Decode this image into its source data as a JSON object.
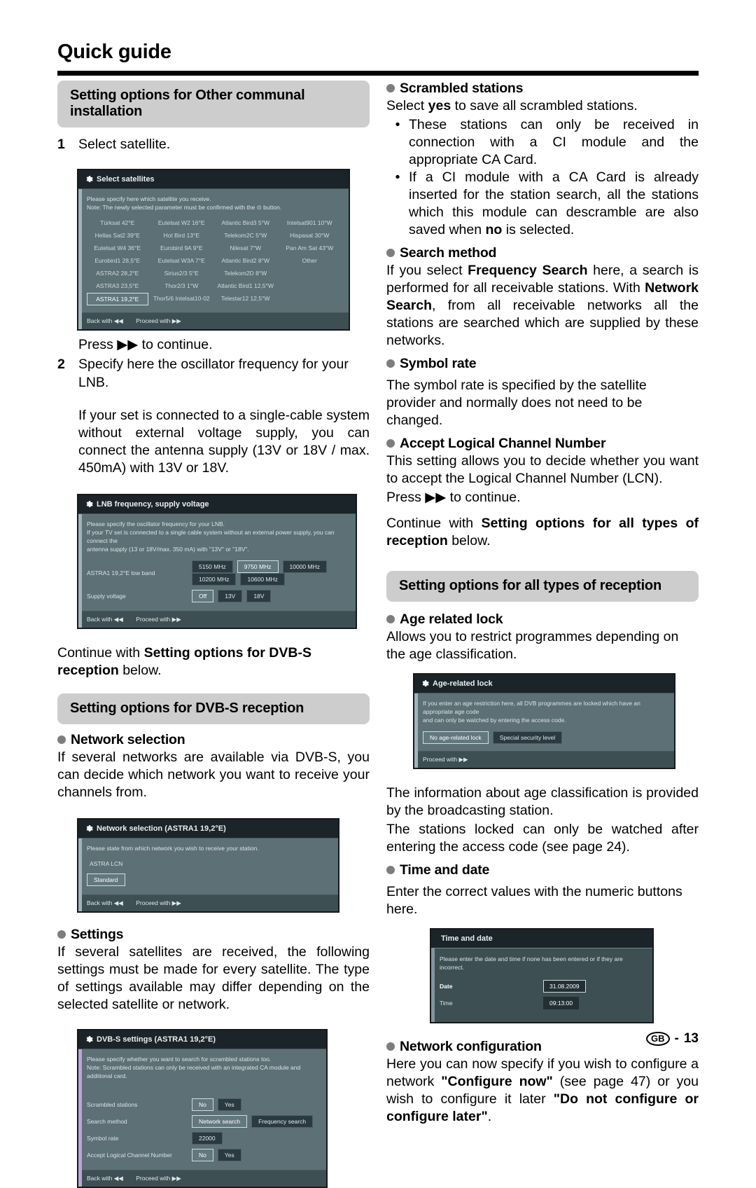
{
  "header": {
    "title": "Quick guide"
  },
  "footer": {
    "locale": "GB",
    "sep": "-",
    "page": "13"
  },
  "left": {
    "banner_other": "Setting options for Other communal installation",
    "step1_num": "1",
    "step1_text": "Select satellite.",
    "press_continue_1": "Press ▶▶ to continue.",
    "step2_num": "2",
    "step2_text": "Specify here the oscillator frequency for your LNB.",
    "lnb_para": "If your set is connected to a single-cable system without external voltage supply, you can connect the antenna  supply (13V or 18V / max. 450mA) with 13V or 18V.",
    "continue_dvbs_pre": "Continue with ",
    "continue_dvbs_bold": "Setting options for DVB-S reception",
    "continue_dvbs_post": " below.",
    "banner_dvbs": "Setting options for DVB-S reception",
    "network_selection_head": "Network selection",
    "network_selection_text": "If several networks are available via DVB-S, you can decide which network you want to receive your channels from.",
    "settings_head": "Settings",
    "settings_text": "If several satellites are received, the following settings must be made for every satellite. The type of settings available may differ depending on the selected satellite or network."
  },
  "right": {
    "scrambled_head": "Scrambled stations",
    "scrambled_lead_pre": "Select ",
    "scrambled_lead_bold": "yes",
    "scrambled_lead_post": " to save all scrambled stations.",
    "scrambled_b1": "These stations can only be received in connection with a CI module and the appropriate CA Card.",
    "scrambled_b2_pre": "If a CI module with a CA Card is already inserted for the station search, all the stations which this module can descramble are also saved when ",
    "scrambled_b2_bold": "no",
    "scrambled_b2_post": " is selected.",
    "bullet_glyph": "•",
    "search_method_head": "Search method",
    "search_method_t1": "If you select ",
    "search_method_b1": "Frequency Search",
    "search_method_t2": " here, a search is performed for all receivable stations. With ",
    "search_method_b2": "Network Search",
    "search_method_t3": ", from all receivable networks all the stations are searched which are supplied by these networks.",
    "symbol_rate_head": "Symbol rate",
    "symbol_rate_text": "The symbol rate is specified by the satellite provider and normally does not need to be changed.",
    "lcn_head": "Accept Logical Channel Number",
    "lcn_text": "This setting allows you to decide whether you want to accept the Logical Channel Number (LCN).",
    "press_continue_2": "Press ▶▶ to continue.",
    "continue_all_pre": "Continue with ",
    "continue_all_bold": "Setting options for all types of reception",
    "continue_all_post": " below.",
    "banner_all": "Setting options for all types of reception",
    "age_lock_head": "Age related lock",
    "age_lock_text": "Allows you to restrict programmes depending on the age classification.",
    "age_info_1": "The information about age classification is provided by the broadcasting station.",
    "age_info_2": "The stations locked can only be watched after entering the access code (see page 24).",
    "time_date_head": "Time and date",
    "time_date_text": "Enter the correct values with the numeric buttons here.",
    "netconf_head": "Network configuration",
    "netconf_t1": "Here you can now specify if you wish to configure a network  ",
    "netconf_b1": "\"Configure now\"",
    "netconf_t2": " (see page 47) or you wish to configure it later ",
    "netconf_b2": "\"Do not configure or configure later\"",
    "netconf_t3": "."
  },
  "osd": {
    "select_satellites": {
      "title": "Select satellites",
      "note_line1": "Please specify here which satellite you receive.",
      "note_line2": "Note: The newly selected parameter must be confirmed with the ⊙ button.",
      "satellites": [
        "Türksat 42°E",
        "Eutelsat W2 16°E",
        "Atlantic Bird3 5°W",
        "Intelsat901 10°W",
        "Hellas Sat2 39°E",
        "Hot Bird 13°E",
        "Telekom2C 5°W",
        "Hispasat 30°W",
        "Eutelsat W4 36°E",
        "Eurobird 9A 9°E",
        "Nilesat 7°W",
        "Pan Am Sat 43°W",
        "Eurobird1 28,5°E",
        "Eutelsat W3A 7°E",
        "Atlantic Bird2 8°W",
        "Other",
        "ASTRA2 28,2°E",
        "Sirius2/3 5°E",
        "Telekom2D 8°W",
        "",
        "ASTRA3 23,5°E",
        "Thor2/3 1°W",
        "Atlantic Bird1 12,5°W",
        "",
        "ASTRA1 19,2°E",
        "Thor5/6 Intelsat10-02",
        "Telestar12 12,5°W",
        ""
      ],
      "selected": "ASTRA1 19,2°E",
      "back_label": "Back with ◀◀",
      "proceed_label": "Proceed with ▶▶"
    },
    "lnb": {
      "title": "LNB frequency, supply voltage",
      "note_line1": "Please specify the oscillator frequency for your LNB.",
      "note_line2": "If your TV set is connected to a single cable system without an external power supply, you can connect the",
      "note_line3": "antenna supply (13 or 18V/max. 350 mA) with \"13V\" or \"18V\".",
      "freq_label": "ASTRA1 19,2°E low band",
      "freq_options": [
        "5150 MHz",
        "9750 MHz",
        "10000 MHz",
        "10200 MHz",
        "10600 MHz"
      ],
      "freq_selected": "9750 MHz",
      "supply_label": "Supply voltage",
      "supply_options": [
        "Off",
        "13V",
        "18V"
      ],
      "supply_selected": "Off",
      "back_label": "Back with ◀◀",
      "proceed_label": "Proceed with ▶▶"
    },
    "network_selection": {
      "title": "Network selection (ASTRA1 19,2°E)",
      "note_line1": "Please state from which network you wish to receive your station.",
      "network_name": "ASTRA LCN",
      "option": "Standard",
      "back_label": "Back with ◀◀",
      "proceed_label": "Proceed with ▶▶"
    },
    "dvbs_settings": {
      "title": "DVB-S settings (ASTRA1 19,2°E)",
      "note_line1": "Please specify whether you want to search for scrambled stations too.",
      "note_line2": "Note: Scrambled stations can only be received with an integrated CA module and additional card.",
      "rows": [
        {
          "label": "Scrambled stations",
          "options": [
            "No",
            "Yes"
          ],
          "selected": "No"
        },
        {
          "label": "Search method",
          "options": [
            "Network search",
            "Frequency search"
          ],
          "selected": "Network search"
        },
        {
          "label": "Symbol rate",
          "value": "22000"
        },
        {
          "label": "Accept Logical Channel Number",
          "options": [
            "No",
            "Yes"
          ],
          "selected": "No"
        }
      ],
      "back_label": "Back with ◀◀",
      "proceed_label": "Proceed with ▶▶"
    },
    "age_lock": {
      "title": "Age-related lock",
      "note_line1": "If you enter an age restriction here, all DVB programmes are locked which have an appropriate age code",
      "note_line2": "and can only be watched by entering the access code.",
      "options": [
        "No age-related lock",
        "Special security level"
      ],
      "selected": "No age-related lock",
      "proceed_label": "Proceed with ▶▶"
    },
    "time_date": {
      "title": "Time and date",
      "note_line1": "Please enter the date and time if none has been entered or if they are",
      "note_line2": "incorrect.",
      "date_label": "Date",
      "date_value": "31.08.2009",
      "time_label": "Time",
      "time_value": "09:13:00"
    }
  }
}
